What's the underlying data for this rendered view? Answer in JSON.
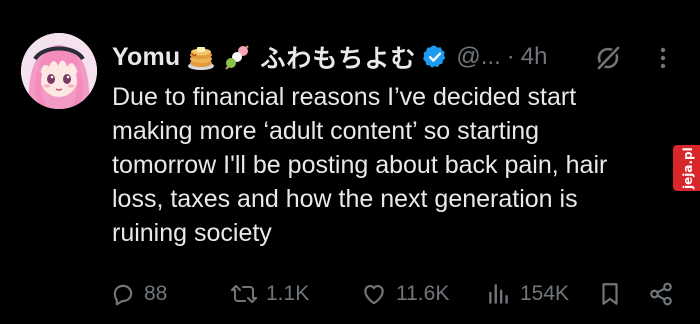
{
  "tweet": {
    "display_name": "Yomu",
    "emojis": [
      "pancakes-emoji",
      "dango-emoji"
    ],
    "jp_name": "ふわもちよむ",
    "verified_icon": "verified-badge-icon",
    "handle": "@...",
    "separator": "·",
    "time": "4h",
    "body_lines": [
      "Due to financial reasons I’ve decided start",
      "making more ‘adult content’ so starting",
      "tomorrow I'll be posting about back pain, hair",
      "loss, taxes and how the next generation is",
      "ruining society"
    ]
  },
  "actions": {
    "replies": "88",
    "reposts": "1.1K",
    "likes": "11.6K",
    "views": "154K"
  },
  "watermark": {
    "text": "jeja.pl"
  },
  "colors": {
    "background": "#000000",
    "text_primary": "#e7e9ea",
    "text_secondary": "#71767b",
    "verified": "#1d9bf0",
    "watermark_red": "#d8262a"
  }
}
